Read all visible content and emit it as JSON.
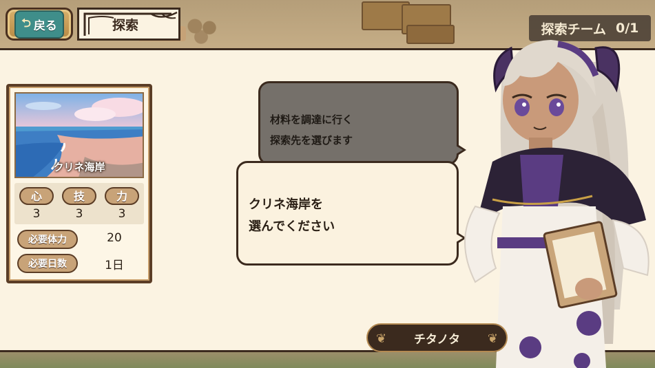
{
  "header": {
    "back_label": "戻る",
    "back_icon": "return-arrow-icon",
    "title": "探索",
    "team_label": "探索チーム",
    "team_count": "0/1"
  },
  "location": {
    "name": "クリネ海岸",
    "stats": [
      {
        "label": "心",
        "value": "3"
      },
      {
        "label": "技",
        "value": "3"
      },
      {
        "label": "力",
        "value": "3"
      }
    ],
    "requirements": [
      {
        "label": "必要体力",
        "value": "20"
      },
      {
        "label": "必要日数",
        "value": "1日"
      }
    ]
  },
  "dialogue": {
    "previous_line1": "材料を調達に行く",
    "previous_line2": "探索先を選びます",
    "current_line1": "クリネ海岸を",
    "current_line2": "選んでください",
    "speaker": "チタノタ"
  },
  "colors": {
    "panel_bg": "#fbf3e2",
    "border_dark": "#3b2a1e",
    "badge_tan": "#c8a378",
    "back_teal": "#3f8e8a",
    "bubble_dark": "#75706a"
  }
}
